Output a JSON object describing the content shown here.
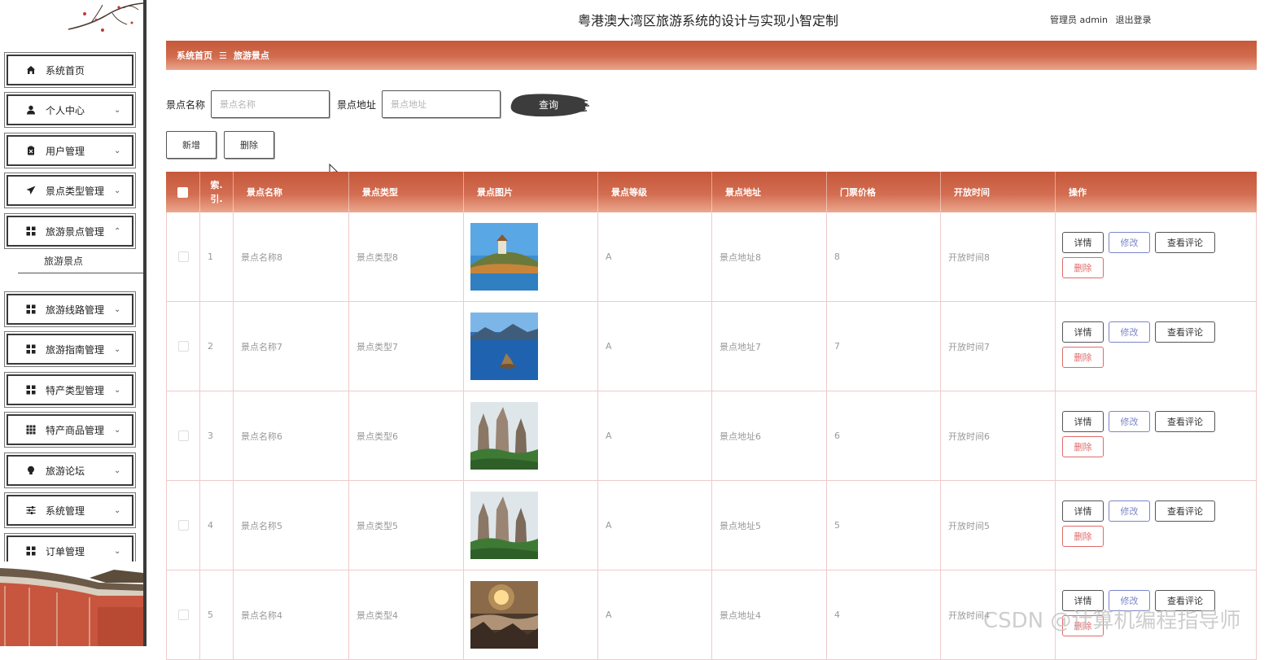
{
  "header": {
    "app_title": "粤港澳大湾区旅游系统的设计与实现小智定制",
    "user_label": "管理员 admin",
    "logout_label": "退出登录"
  },
  "sidebar": {
    "items": [
      {
        "label": "系统首页",
        "icon": "home-icon"
      },
      {
        "label": "个人中心",
        "icon": "user-icon"
      },
      {
        "label": "用户管理",
        "icon": "clipboard-icon"
      },
      {
        "label": "景点类型管理",
        "icon": "paper-plane-icon"
      },
      {
        "label": "旅游景点管理",
        "icon": "grid-icon",
        "expanded": true
      },
      {
        "label": "旅游线路管理",
        "icon": "grid-icon"
      },
      {
        "label": "旅游指南管理",
        "icon": "grid-icon"
      },
      {
        "label": "特产类型管理",
        "icon": "grid-icon"
      },
      {
        "label": "特产商品管理",
        "icon": "grid9-icon"
      },
      {
        "label": "旅游论坛",
        "icon": "bulb-icon"
      },
      {
        "label": "系统管理",
        "icon": "sliders-icon"
      },
      {
        "label": "订单管理",
        "icon": "grid-icon"
      }
    ],
    "submenu": {
      "label": "旅游景点"
    }
  },
  "breadcrumb": {
    "home": "系统首页",
    "separator": "☰",
    "current": "旅游景点"
  },
  "search": {
    "name_label": "景点名称",
    "name_placeholder": "景点名称",
    "name_value": "",
    "address_label": "景点地址",
    "address_placeholder": "景点地址",
    "address_value": "",
    "query_button": "查询"
  },
  "actions": {
    "add": "新增",
    "delete": "删除"
  },
  "table": {
    "columns": [
      "索引",
      "景点名称",
      "景点类型",
      "景点图片",
      "景点等级",
      "景点地址",
      "门票价格",
      "开放时间",
      "操作"
    ],
    "index_header_line1": "索.",
    "index_header_line2": "引.",
    "rows": [
      {
        "index": "1",
        "name": "景点名称8",
        "type": "景点类型8",
        "image": "pagoda-lake-photo",
        "grade": "A",
        "address": "景点地址8",
        "price": "8",
        "open_time": "开放时间8"
      },
      {
        "index": "2",
        "name": "景点名称7",
        "type": "景点类型7",
        "image": "blue-lake-island-photo",
        "grade": "A",
        "address": "景点地址7",
        "price": "7",
        "open_time": "开放时间7"
      },
      {
        "index": "3",
        "name": "景点名称6",
        "type": "景点类型6",
        "image": "karst-pillars-photo",
        "grade": "A",
        "address": "景点地址6",
        "price": "6",
        "open_time": "开放时间6"
      },
      {
        "index": "4",
        "name": "景点名称5",
        "type": "景点类型5",
        "image": "karst-pillars-photo",
        "grade": "A",
        "address": "景点地址5",
        "price": "5",
        "open_time": "开放时间5"
      },
      {
        "index": "5",
        "name": "景点名称4",
        "type": "景点类型4",
        "image": "sunrise-clouds-photo",
        "grade": "A",
        "address": "景点地址4",
        "price": "4",
        "open_time": "开放时间4"
      }
    ],
    "op_labels": {
      "detail": "详情",
      "edit": "修改",
      "comments": "查看评论",
      "delete": "删除"
    }
  },
  "watermark": "CSDN @计算机编程指导师",
  "colors": {
    "accent": "#c5583a",
    "accent_light": "#eba88f",
    "edit": "#7b86c8",
    "danger": "#e06a6a",
    "row_border": "#f0caca"
  }
}
